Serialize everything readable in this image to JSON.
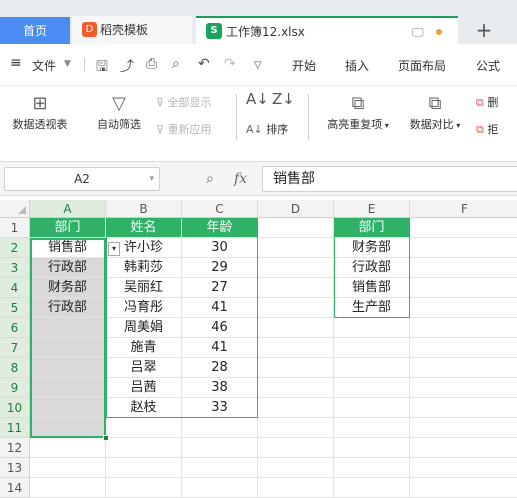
{
  "tabs": {
    "home": "首页",
    "templates": "稻壳模板",
    "templates_icon": "D",
    "workbook": "工作簿12.xlsx",
    "workbook_icon": "S",
    "new_tab": "+"
  },
  "menu": {
    "file": "文件",
    "items": [
      "开始",
      "插入",
      "页面布局",
      "公式"
    ]
  },
  "ribbon": {
    "pivot": "数据透视表",
    "autofilter": "自动筛选",
    "show_all": "全部显示",
    "reapply": "重新应用",
    "sort": "排序",
    "highlight_dup": "高亮重复项",
    "compare": "数据对比",
    "delete_dup": "删",
    "reject_dup": "拒"
  },
  "formula_bar": {
    "name_box": "A2",
    "fx": "fx",
    "value": "销售部"
  },
  "sheet": {
    "columns": [
      "A",
      "B",
      "C",
      "D",
      "E",
      "F"
    ],
    "rows": [
      "1",
      "2",
      "3",
      "4",
      "5",
      "6",
      "7",
      "8",
      "9",
      "10",
      "11",
      "12",
      "13",
      "14"
    ],
    "col_a": [
      "部门",
      "销售部",
      "行政部",
      "财务部",
      "行政部"
    ],
    "col_b": [
      "姓名",
      "许小珍",
      "韩莉莎",
      "吴丽红",
      "冯育彤",
      "周美娟",
      "施青",
      "吕翠",
      "吕茜",
      "赵枝"
    ],
    "col_c": [
      "年龄",
      "30",
      "29",
      "27",
      "41",
      "46",
      "41",
      "28",
      "38",
      "33"
    ],
    "col_e": [
      "部门",
      "财务部",
      "行政部",
      "销售部",
      "生产部"
    ]
  },
  "colors": {
    "header_green": "#2fb168",
    "selection_gray": "#d9d9d9",
    "home_tab_blue": "#4a8cf0"
  }
}
